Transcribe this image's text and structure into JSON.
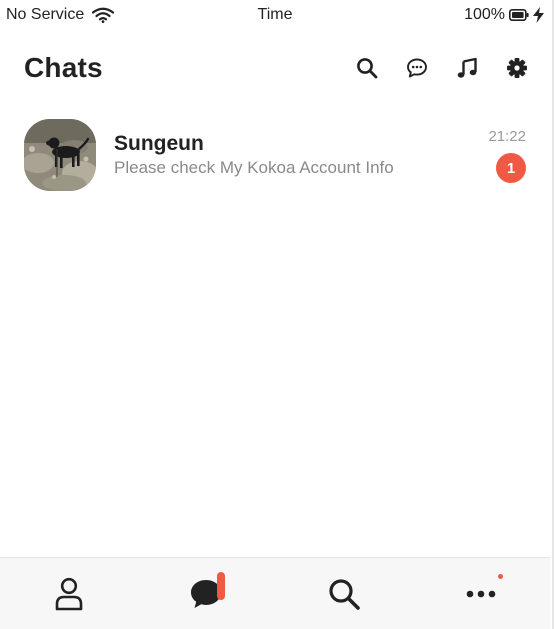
{
  "status_bar": {
    "carrier": "No Service",
    "time": "Time",
    "battery": "100%",
    "icons": [
      "wifi-icon",
      "battery-icon",
      "charging-bolt-icon"
    ]
  },
  "header": {
    "title": "Chats",
    "actions": [
      "search-icon",
      "new-chat-icon",
      "music-icon",
      "settings-icon"
    ]
  },
  "chats": [
    {
      "name": "Sungeun",
      "preview": "Please check My Kokoa Account Info",
      "time": "21:22",
      "unread": "1"
    }
  ],
  "tab_bar": {
    "tabs": [
      {
        "icon": "person-icon",
        "active": false
      },
      {
        "icon": "chat-bubble-icon",
        "active": true,
        "badge": true
      },
      {
        "icon": "search-icon",
        "active": false
      },
      {
        "icon": "more-icon",
        "active": false,
        "dot": true
      }
    ]
  },
  "colors": {
    "accent": "#f05a45",
    "text": "#222222",
    "muted": "#8a8a8a",
    "tab_bar_bg": "#f7f7f7"
  }
}
